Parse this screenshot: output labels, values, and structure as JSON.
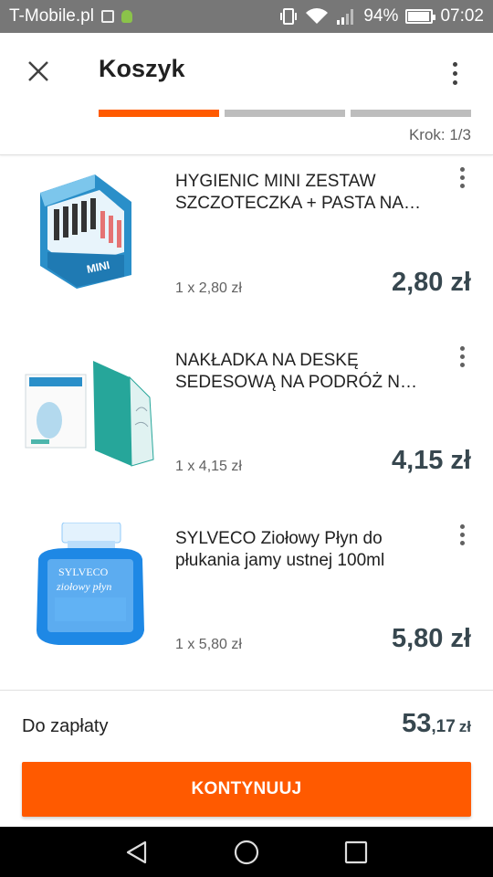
{
  "status_bar": {
    "carrier": "T-Mobile.pl",
    "battery": "94%",
    "battery_level": 0.94,
    "time": "07:02"
  },
  "header": {
    "title": "Koszyk",
    "step_label": "Krok: 1/3",
    "steps_total": 3,
    "step_current": 1
  },
  "colors": {
    "accent": "#ff5a00",
    "price": "#37474f",
    "step_inactive": "#bdbdbd"
  },
  "cart": {
    "items": [
      {
        "name": "HYGIENIC MINI ZESTAW SZCZOTECZKA + PASTA NA…",
        "qty_price": "1 x 2,80 zł",
        "price": "2,80 zł",
        "image": "toothbrush-display-box"
      },
      {
        "name": "NAKŁADKA NA DESKĘ SEDESOWĄ NA PODRÓŻ N…",
        "qty_price": "1 x 4,15 zł",
        "price": "4,15 zł",
        "image": "toilet-seat-cover-pack"
      },
      {
        "name": "SYLVECO Ziołowy Płyn do płukania jamy ustnej 100ml",
        "qty_price": "1 x 5,80 zł",
        "price": "5,80 zł",
        "image": "mouthwash-bottle"
      }
    ]
  },
  "footer": {
    "label": "Do zapłaty",
    "total_int": "53",
    "total_dec": ",17",
    "currency": "zł",
    "button": "KONTYNUUJ"
  },
  "nav": {
    "back_icon": "back-triangle-icon",
    "home_icon": "home-circle-icon",
    "recents_icon": "recents-square-icon"
  }
}
